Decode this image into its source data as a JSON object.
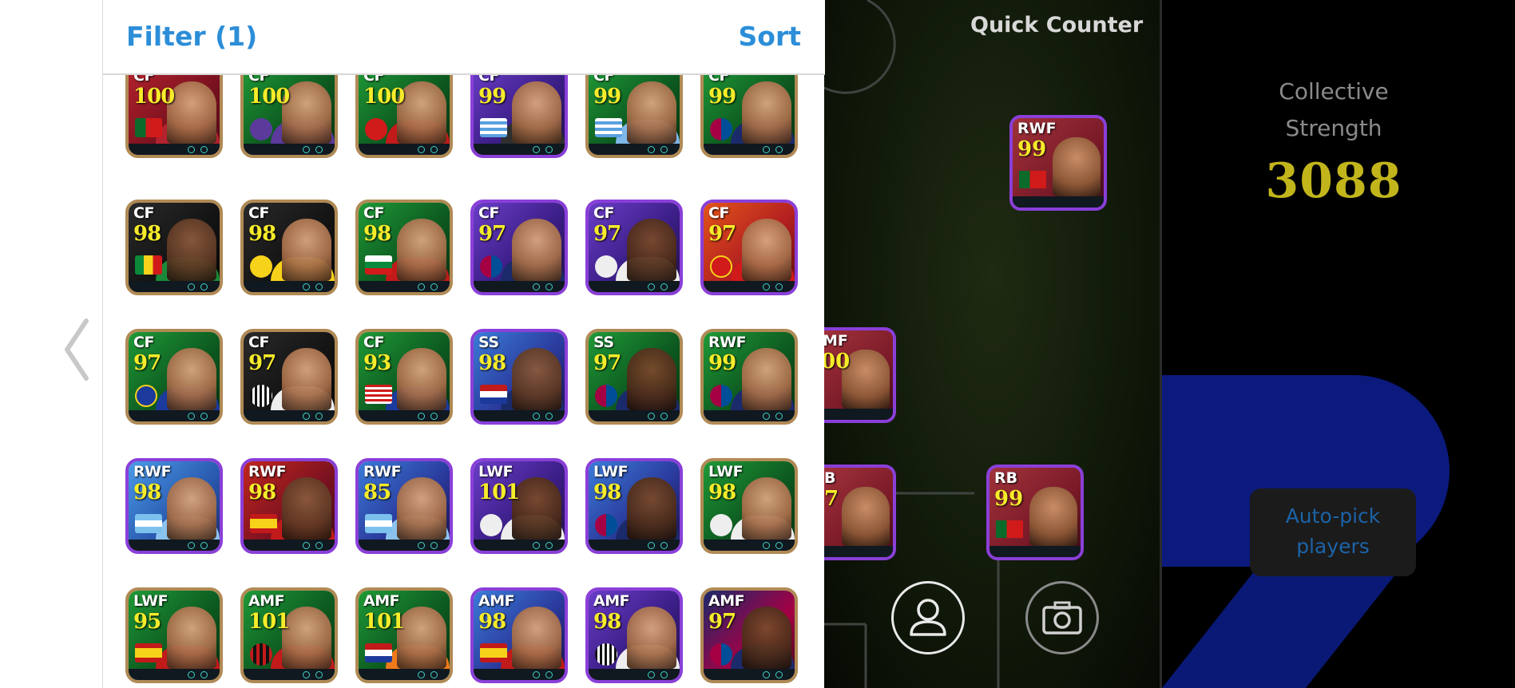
{
  "header": {
    "filter_label": "Filter (1)",
    "sort_label": "Sort"
  },
  "game_area": {
    "title": "Quick Counter"
  },
  "summary": {
    "collective_strength_label_line1": "Collective",
    "collective_strength_label_line2": "Strength",
    "collective_strength_value": "3088",
    "autopick_line1": "Auto-pick",
    "autopick_line2": "players"
  },
  "player_cards": [
    {
      "pos": "CF",
      "rating": "100"
    },
    {
      "pos": "CF",
      "rating": "100"
    },
    {
      "pos": "CF",
      "rating": "100"
    },
    {
      "pos": "CF",
      "rating": "99"
    },
    {
      "pos": "CF",
      "rating": "99"
    },
    {
      "pos": "CF",
      "rating": "99"
    },
    {
      "pos": "CF",
      "rating": "98"
    },
    {
      "pos": "CF",
      "rating": "98"
    },
    {
      "pos": "CF",
      "rating": "98"
    },
    {
      "pos": "CF",
      "rating": "97"
    },
    {
      "pos": "CF",
      "rating": "97"
    },
    {
      "pos": "CF",
      "rating": "97"
    },
    {
      "pos": "CF",
      "rating": "97"
    },
    {
      "pos": "CF",
      "rating": "97"
    },
    {
      "pos": "CF",
      "rating": "93"
    },
    {
      "pos": "SS",
      "rating": "98"
    },
    {
      "pos": "SS",
      "rating": "97"
    },
    {
      "pos": "RWF",
      "rating": "99"
    },
    {
      "pos": "RWF",
      "rating": "98"
    },
    {
      "pos": "RWF",
      "rating": "98"
    },
    {
      "pos": "RWF",
      "rating": "85"
    },
    {
      "pos": "LWF",
      "rating": "101"
    },
    {
      "pos": "LWF",
      "rating": "98"
    },
    {
      "pos": "LWF",
      "rating": "98"
    },
    {
      "pos": "LWF",
      "rating": "95"
    },
    {
      "pos": "AMF",
      "rating": "101"
    },
    {
      "pos": "AMF",
      "rating": "101"
    },
    {
      "pos": "AMF",
      "rating": "98"
    },
    {
      "pos": "AMF",
      "rating": "98"
    },
    {
      "pos": "AMF",
      "rating": "97"
    }
  ],
  "field_cards": [
    {
      "pos": "RWF",
      "rating": "99"
    },
    {
      "pos": "MF",
      "rating": "00"
    },
    {
      "pos": "B",
      "rating": "7"
    },
    {
      "pos": "RB",
      "rating": "99"
    }
  ],
  "colors": {
    "accent_blue": "#2c8ed8",
    "rating_yellow": "#f6ec2a",
    "strength_gold": "#c2b51c",
    "autopick_text": "#1c63a8"
  }
}
